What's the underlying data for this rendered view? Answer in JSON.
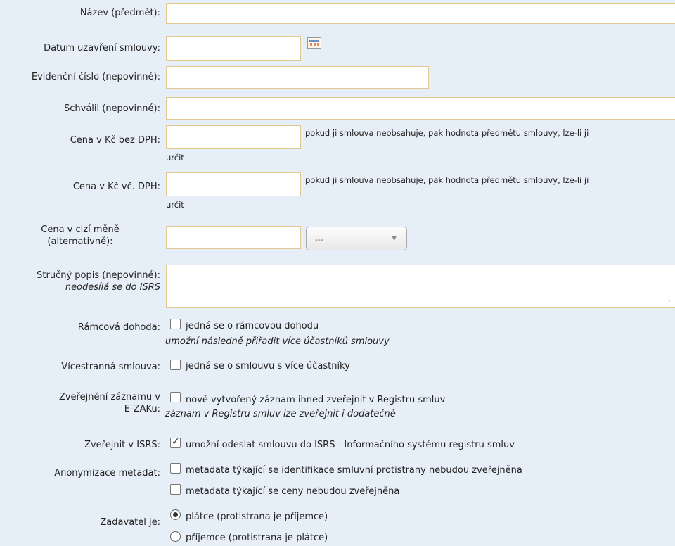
{
  "fields": {
    "nazev": "Název (předmět):",
    "datum": "Datum uzavření smlouvy:",
    "evidencni": "Evidenční číslo (nepovinné):",
    "schvalil": "Schválil (nepovinné):",
    "cena_bez": "Cena v Kč bez DPH:",
    "cena_vc": "Cena v Kč vč. DPH:",
    "cena_cizi_1": "Cena v cizí měně",
    "cena_cizi_2": "(alternativně):",
    "popis_1": "Stručný popis (nepovinné):",
    "popis_2": "neodesílá se do ISRS",
    "ramcova": "Rámcová dohoda:",
    "vicestranna": "Vícestranná smlouva:",
    "zverejneni_1": "Zveřejnění záznamu v",
    "zverejneni_2": "E-ZAKu:",
    "isrs": "Zveřejnit v ISRS:",
    "anonym": "Anonymizace metadat:",
    "zadavatel": "Zadavatel je:"
  },
  "price_note_1": "pokud ji smlouva neobsahuje, pak hodnota předmětu smlouvy, lze-li ji",
  "price_note_2": "určit",
  "currency_select": "---",
  "options": {
    "ramcova": "jedná se o rámcovou dohodu",
    "ramcova_sub": "umožní následně přiřadit více účastníků smlouvy",
    "vicestranna": "jedná se o smlouvu s více účastníky",
    "zverejneni": "nově vytvořený záznam ihned zveřejnit v Registru smluv",
    "zverejneni_sub": "záznam v Registru smluv lze zveřejnit i dodatečně",
    "isrs": "umožní odeslat smlouvu do ISRS - Informačního systému registru smluv",
    "anonym_1": "metadata týkající se identifikace smluvní protistrany nebudou zveřejněna",
    "anonym_2": "metadata týkající se ceny nebudou zveřejněna",
    "platce": "plátce (protistrana je příjemce)",
    "prijemce": "příjemce (protistrana je plátce)"
  },
  "state": {
    "isrs_checked": true,
    "zadavatel_selected": "platce"
  }
}
